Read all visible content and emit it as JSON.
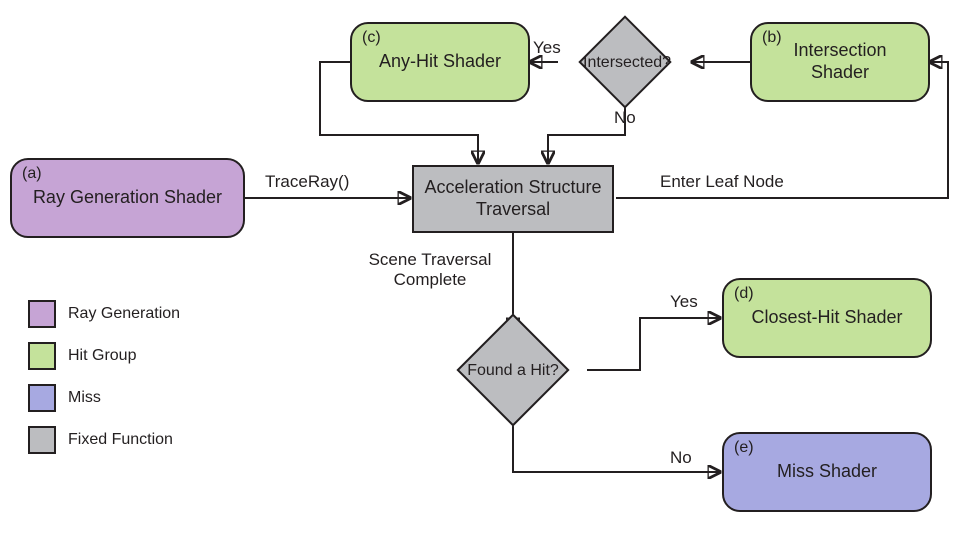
{
  "chart_data": {
    "type": "flowchart",
    "nodes": [
      {
        "id": "a",
        "label": "Ray Generation Shader",
        "kind": "shader",
        "category": "Ray Generation"
      },
      {
        "id": "b",
        "label": "Intersection Shader",
        "kind": "shader",
        "category": "Hit Group"
      },
      {
        "id": "c",
        "label": "Any-Hit Shader",
        "kind": "shader",
        "category": "Hit Group"
      },
      {
        "id": "d",
        "label": "Closest-Hit Shader",
        "kind": "shader",
        "category": "Hit Group"
      },
      {
        "id": "e",
        "label": "Miss Shader",
        "kind": "shader",
        "category": "Miss"
      },
      {
        "id": "traversal",
        "label": "Acceleration Structure Traversal",
        "kind": "process",
        "category": "Fixed Function"
      },
      {
        "id": "intersected",
        "label": "Intersected?",
        "kind": "decision",
        "category": "Fixed Function"
      },
      {
        "id": "foundhit",
        "label": "Found a Hit?",
        "kind": "decision",
        "category": "Fixed Function"
      }
    ],
    "edges": [
      {
        "from": "a",
        "to": "traversal",
        "label": "TraceRay()"
      },
      {
        "from": "traversal",
        "to": "b",
        "label": "Enter Leaf Node"
      },
      {
        "from": "b",
        "to": "intersected",
        "label": ""
      },
      {
        "from": "intersected",
        "to": "c",
        "label": "Yes"
      },
      {
        "from": "intersected",
        "to": "traversal",
        "label": "No"
      },
      {
        "from": "c",
        "to": "traversal",
        "label": ""
      },
      {
        "from": "traversal",
        "to": "foundhit",
        "label": "Scene Traversal Complete"
      },
      {
        "from": "foundhit",
        "to": "d",
        "label": "Yes"
      },
      {
        "from": "foundhit",
        "to": "e",
        "label": "No"
      }
    ],
    "legend": [
      {
        "color": "#c6a4d5",
        "label": "Ray Generation"
      },
      {
        "color": "#c4e29b",
        "label": "Hit Group"
      },
      {
        "color": "#a7a9e1",
        "label": "Miss"
      },
      {
        "color": "#bcbdc0",
        "label": "Fixed Function"
      }
    ]
  },
  "nodes": {
    "a": {
      "tag": "(a)",
      "label": "Ray Generation Shader"
    },
    "b": {
      "tag": "(b)",
      "label": "Intersection\nShader"
    },
    "c": {
      "tag": "(c)",
      "label": "Any-Hit Shader"
    },
    "d": {
      "tag": "(d)",
      "label": "Closest-Hit Shader"
    },
    "e": {
      "tag": "(e)",
      "label": "Miss Shader"
    },
    "traversal": {
      "label": "Acceleration Structure\nTraversal"
    },
    "intersected": {
      "label": "Intersected?"
    },
    "foundhit": {
      "label": "Found a Hit?"
    }
  },
  "edges": {
    "traceray": "TraceRay()",
    "enterleaf": "Enter Leaf Node",
    "int_yes": "Yes",
    "int_no": "No",
    "scene_complete": "Scene Traversal\nComplete",
    "found_yes": "Yes",
    "found_no": "No"
  },
  "legend": {
    "raygen": "Ray Generation",
    "hitgroup": "Hit Group",
    "miss": "Miss",
    "fixed": "Fixed Function"
  }
}
